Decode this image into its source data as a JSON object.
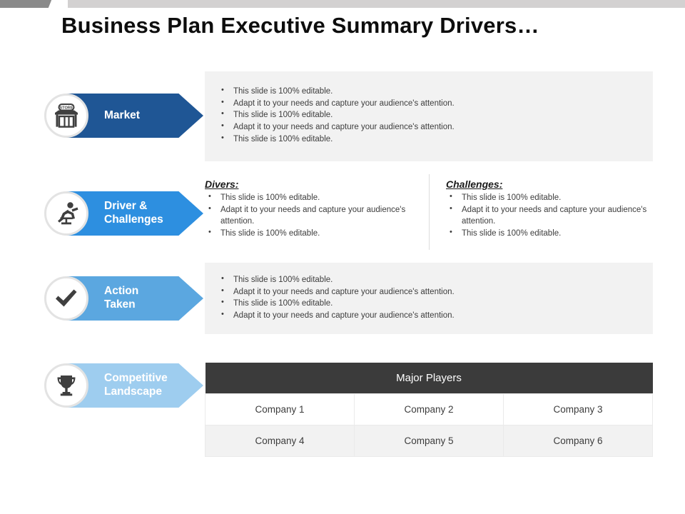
{
  "slide": {
    "title": "Business Plan Executive Summary Drivers…"
  },
  "colors": {
    "arrow_market": "#1f5695",
    "arrow_driver": "#2d8fe0",
    "arrow_action": "#5ba7e0",
    "arrow_competitive": "#9ecdef",
    "panel_gray": "#f2f2f2",
    "table_header": "#3b3b3b",
    "topbar_dark": "#8a8a8a",
    "topbar_light": "#d3d1d1",
    "icon_dark": "#3f3f3f"
  },
  "rows": [
    {
      "id": "market",
      "label": "Market",
      "icon": "store-icon",
      "bullets": [
        "This slide is 100% editable.",
        " Adapt it to your needs and capture your audience's attention.",
        "This slide is 100% editable.",
        "Adapt it to your needs and capture your audience's attention.",
        "This slide is 100% editable."
      ]
    },
    {
      "id": "driver-challenges",
      "label": "Driver &\nChallenges",
      "icon": "runner-hurdle-icon",
      "columns": [
        {
          "heading": "Divers:",
          "bullets": [
            "This slide is 100% editable.",
            " Adapt it to your needs and capture your audience's attention.",
            "This slide is 100% editable."
          ]
        },
        {
          "heading": "Challenges:",
          "bullets": [
            "This slide is 100% editable.",
            " Adapt it to your needs and capture your audience's attention.",
            "This slide is 100% editable."
          ]
        }
      ]
    },
    {
      "id": "action-taken",
      "label": "Action\nTaken",
      "icon": "checkmark-icon",
      "bullets": [
        "This slide is 100% editable.",
        " Adapt it to your needs and capture your audience's attention.",
        "This slide is 100% editable.",
        "Adapt it to your needs and capture your audience's attention."
      ]
    },
    {
      "id": "competitive-landscape",
      "label": "Competitive\nLandscape",
      "icon": "trophy-icon"
    }
  ],
  "players_table": {
    "header": "Major Players",
    "rows": [
      [
        "Company 1",
        "Company 2",
        "Company 3"
      ],
      [
        "Company 4",
        "Company 5",
        "Company 6"
      ]
    ]
  }
}
